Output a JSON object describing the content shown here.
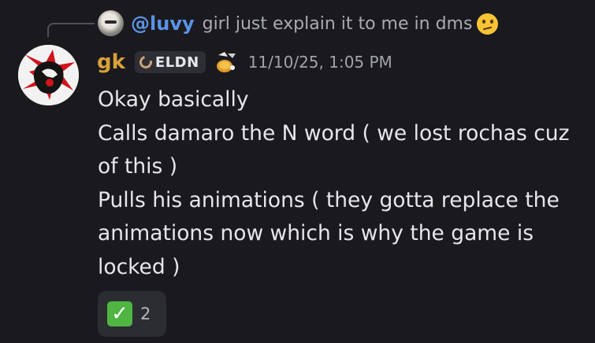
{
  "reply": {
    "username": "@luvy",
    "text": "girl just explain it to me in dms",
    "emoji_icon": "confused-face-emoji"
  },
  "author": {
    "username": "gk",
    "username_color": "#d9a13a",
    "tag_label": "ELDN",
    "timestamp": "11/10/25, 1:05 PM"
  },
  "message": {
    "lines": [
      "Okay basically",
      "Calls damaro the N word ( we lost rochas cuz of this )",
      "Pulls his animations ( they gotta replace the animations now which is why the game is locked )"
    ]
  },
  "reaction": {
    "emoji_icon": "check-mark-button-emoji",
    "count": "2"
  },
  "colors": {
    "background": "#1a1a1e",
    "mention": "#5b93e8",
    "reaction_bg": "#2b2d31"
  }
}
